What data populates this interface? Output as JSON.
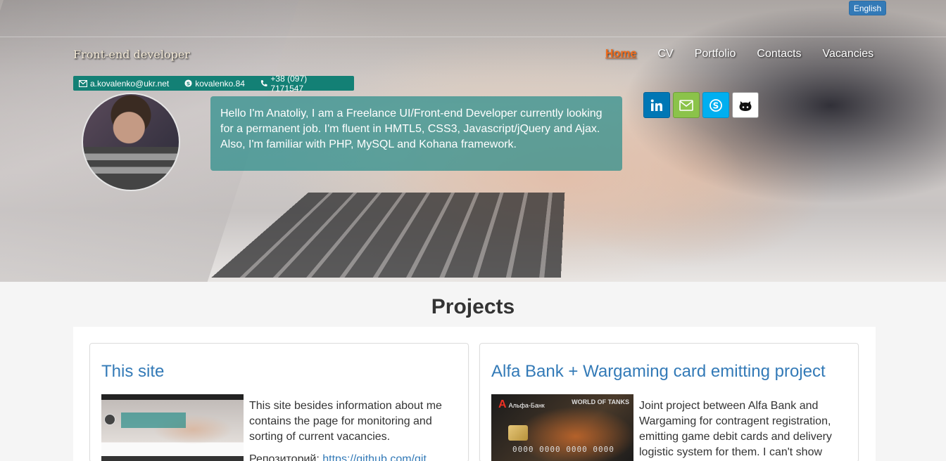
{
  "language": {
    "label": "English"
  },
  "header": {
    "brand": "Front-end developer",
    "nav": [
      {
        "label": "Home",
        "active": true
      },
      {
        "label": "CV",
        "active": false
      },
      {
        "label": "Portfolio",
        "active": false
      },
      {
        "label": "Contacts",
        "active": false
      },
      {
        "label": "Vacancies",
        "active": false
      }
    ]
  },
  "contacts": {
    "email": "a.kovalenko@ukr.net",
    "skype": "kovalenko.84",
    "phone": "+38 (097) 7171547"
  },
  "intro": {
    "text": "Hello I'm Anatoliy, I am a Freelance UI/Front-end Developer currently looking for a permanent job. I'm fluent in HMTL5, CSS3, Javascript/jQuery and Ajax. Also, I'm familiar with PHP, MySQL and Kohana framework."
  },
  "social": [
    {
      "icon": "linkedin-icon",
      "color": "#0077b5"
    },
    {
      "icon": "mail-icon",
      "color": "#8bc34a"
    },
    {
      "icon": "skype-icon",
      "color": "#00aff0"
    },
    {
      "icon": "github-icon",
      "color": "#ffffff"
    }
  ],
  "projects": {
    "title": "Projects",
    "items": [
      {
        "title": "This site",
        "description": "This site besides information about me contains the page for monitoring and sorting of current vacancies.",
        "repo_label": "Репозиторий:",
        "repo_link": "https://github.com/git"
      },
      {
        "title": "Alfa Bank + Wargaming card emitting project",
        "description": "Joint project between Alfa Bank and Wargaming for contragent registration, emitting game debit cards and delivery logistic system for them. I can't show",
        "card_bank": "Альфа-Банк",
        "card_bank_letter": "А",
        "card_brand": "WORLD OF TANKS",
        "card_number": "0000 0000 0000 0000"
      }
    ]
  },
  "colors": {
    "accent": "#337ab7",
    "active_nav": "#f26c1b",
    "contact_bar": "#138075",
    "intro_box": "#2b8e8a"
  }
}
